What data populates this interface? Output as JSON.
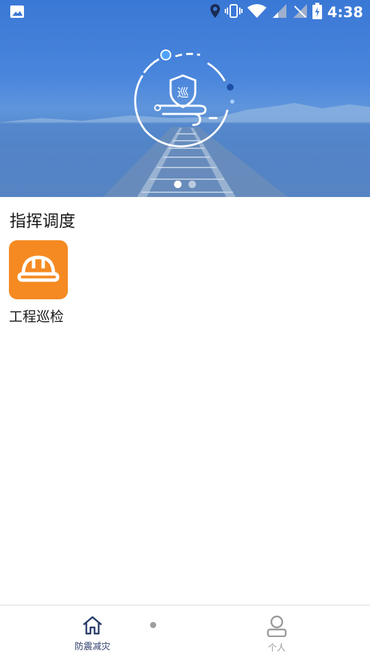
{
  "status_bar": {
    "time": "4:38",
    "icons": [
      "image-icon",
      "location-icon",
      "vibrate-icon",
      "wifi-icon",
      "signal-icon",
      "signal-icon",
      "battery-charging-icon"
    ]
  },
  "banner": {
    "emblem_char": "巡",
    "carousel": {
      "count": 2,
      "active_index": 0
    }
  },
  "section": {
    "title": "指挥调度",
    "apps": [
      {
        "label": "工程巡检",
        "icon": "helmet-icon",
        "color": "#f58a22"
      }
    ]
  },
  "bottom_nav": {
    "items": [
      {
        "label": "防震减灾",
        "icon": "home-icon",
        "active": true
      },
      {
        "label": "个人",
        "icon": "person-icon",
        "active": false
      }
    ]
  },
  "colors": {
    "accent": "#2a3d6b",
    "orange": "#f58a22",
    "banner_blue": "#3a78d6"
  }
}
